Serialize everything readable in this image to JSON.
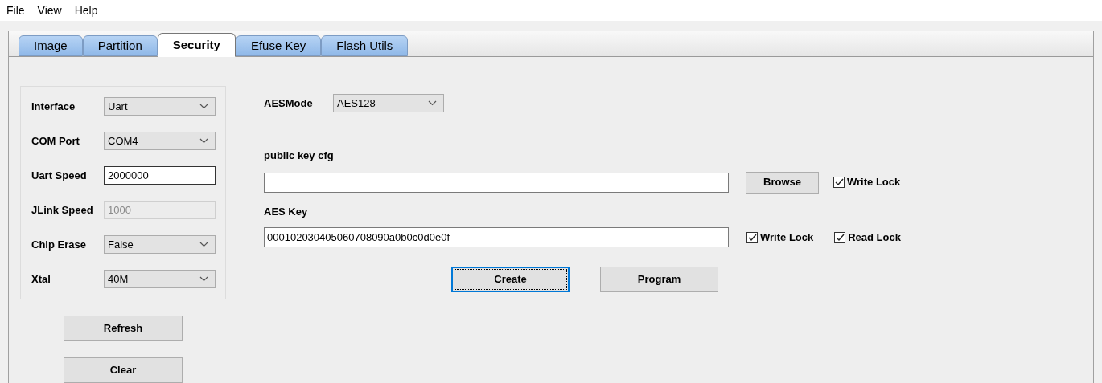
{
  "menu": [
    "File",
    "View",
    "Help"
  ],
  "tabs": [
    {
      "label": "Image",
      "selected": false
    },
    {
      "label": "Partition",
      "selected": false
    },
    {
      "label": "Security",
      "selected": true
    },
    {
      "label": "Efuse Key",
      "selected": false
    },
    {
      "label": "Flash Utils",
      "selected": false
    }
  ],
  "settings": [
    {
      "label": "Interface",
      "kind": "dropdown",
      "value": "Uart"
    },
    {
      "label": "COM Port",
      "kind": "dropdown",
      "value": "COM4"
    },
    {
      "label": "Uart Speed",
      "kind": "input",
      "value": "2000000",
      "disabled": false
    },
    {
      "label": "JLink Speed",
      "kind": "input",
      "value": "1000",
      "disabled": true
    },
    {
      "label": "Chip Erase",
      "kind": "dropdown",
      "value": "False"
    },
    {
      "label": "Xtal",
      "kind": "dropdown",
      "value": "40M"
    }
  ],
  "side_buttons": [
    "Refresh",
    "Clear"
  ],
  "aes_mode": {
    "label": "AESMode",
    "value": "AES128"
  },
  "public_key": {
    "label": "public key cfg",
    "button": "Browse",
    "locks": [
      {
        "label": "Write Lock",
        "checked": true
      }
    ]
  },
  "aes_key": {
    "label": "AES Key",
    "value": "000102030405060708090a0b0c0d0e0f",
    "locks": [
      {
        "label": "Write Lock",
        "checked": true
      },
      {
        "label": "Read Lock",
        "checked": true
      }
    ]
  },
  "actions": [
    {
      "label": "Create",
      "focused": true
    },
    {
      "label": "Program",
      "focused": false
    }
  ]
}
